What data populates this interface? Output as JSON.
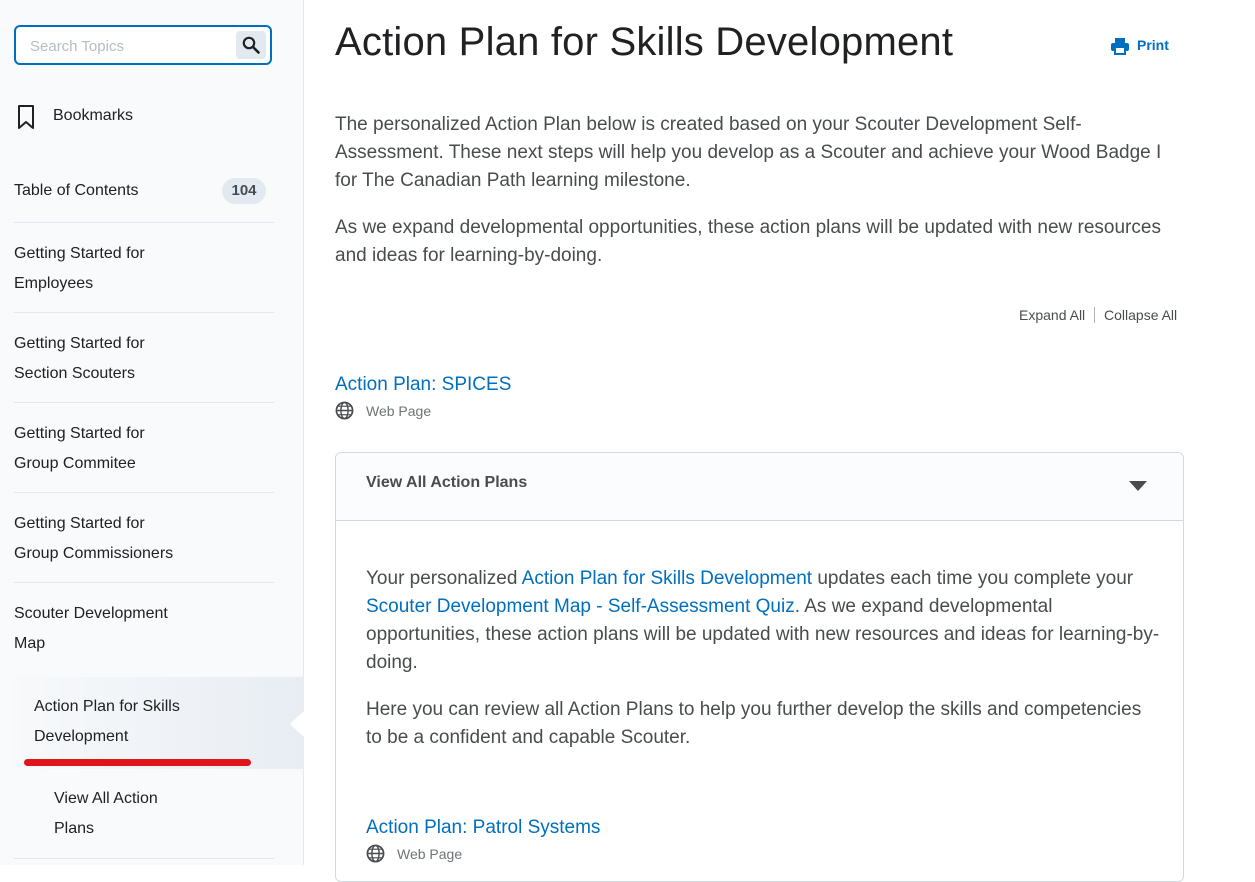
{
  "sidebar": {
    "search": {
      "placeholder": "Search Topics"
    },
    "bookmarks_label": "Bookmarks",
    "toc": {
      "label": "Table of Contents",
      "count": "104"
    },
    "items": [
      {
        "line1": "Getting Started for",
        "line2": "Employees"
      },
      {
        "line1": "Getting Started for",
        "line2": "Section Scouters"
      },
      {
        "line1": "Getting Started for",
        "line2": "Group Commitee"
      },
      {
        "line1": "Getting Started for",
        "line2": "Group Commissioners"
      },
      {
        "line1": "Scouter Development",
        "line2": "Map"
      }
    ],
    "active_item": {
      "line1": "Action Plan for Skills",
      "line2": "Development"
    },
    "sub_item": {
      "line1": "View All Action",
      "line2": "Plans"
    }
  },
  "main": {
    "title": "Action Plan for Skills Development",
    "print_label": "Print",
    "intro": [
      "The personalized Action Plan below is created based on your Scouter Development Self-Assessment. These next steps will help you develop as a Scouter and achieve your Wood Badge I for The Canadian Path learning milestone.",
      "As we expand developmental opportunities, these action plans will be updated with new resources and ideas for learning-by-doing."
    ],
    "expand_all": "Expand All",
    "collapse_all": "Collapse All",
    "topic1": {
      "title": "Action Plan: SPICES",
      "type": "Web Page"
    },
    "panel": {
      "title": "View All Action Plans",
      "para1": {
        "t1": "Your personalized ",
        "link1": "Action Plan for Skills Development",
        "t2": " updates each time you complete your ",
        "link2": "Scouter Development Map - Self-Assessment Quiz",
        "t3": ". As we expand developmental opportunities, these action plans will be updated with new resources and ideas for learning-by-doing."
      },
      "para2": "Here you can review all Action Plans to help you further develop the skills and competencies to be a confident and capable Scouter.",
      "topic": {
        "title": "Action Plan: Patrol Systems",
        "type": "Web Page"
      }
    }
  },
  "colors": {
    "link": "#006fbf",
    "active_underline": "#e0141b",
    "text": "#494c4e"
  },
  "icons": [
    "search-icon",
    "bookmark-icon",
    "print-icon",
    "globe-icon",
    "chevron-down-icon"
  ]
}
